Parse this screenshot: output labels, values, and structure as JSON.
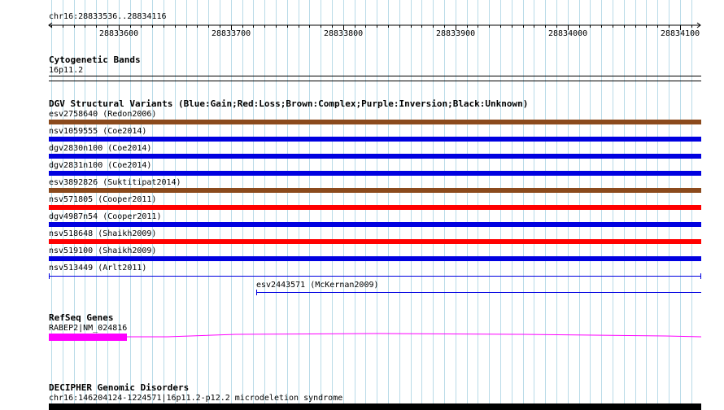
{
  "ruler": {
    "location": "chr16:28833536..28834116",
    "ticks": [
      "28833600",
      "28833700",
      "28833800",
      "28833900",
      "28834000",
      "28834100"
    ]
  },
  "cytoband": {
    "title": "Cytogenetic Bands",
    "band": "16p11.2"
  },
  "dgv": {
    "title": "DGV Structural Variants (Blue:Gain;Red:Loss;Brown:Complex;Purple:Inversion;Black:Unknown)",
    "variants": [
      {
        "label": "esv2758640 (Redon2006)",
        "color": "#8b4a1c"
      },
      {
        "label": "nsv1059555 (Coe2014)",
        "color": "#0000e0"
      },
      {
        "label": "dgv2830n100 (Coe2014)",
        "color": "#0000e0"
      },
      {
        "label": "dgv2831n100 (Coe2014)",
        "color": "#0000e0"
      },
      {
        "label": "esv3892826 (Suktitipat2014)",
        "color": "#8b4a1c"
      },
      {
        "label": "nsv571805 (Cooper2011)",
        "color": "#ff0000"
      },
      {
        "label": "dgv4987n54 (Cooper2011)",
        "color": "#0000e0"
      },
      {
        "label": "nsv518648 (Shaikh2009)",
        "color": "#ff0000"
      },
      {
        "label": "nsv519100 (Shaikh2009)",
        "color": "#0000e0"
      },
      {
        "label": "nsv513449 (Arlt2011)",
        "color": "#0000e0"
      },
      {
        "label": "esv2443571 (McKernan2009)",
        "color": "#0000e0"
      }
    ]
  },
  "refseq": {
    "title": "RefSeq Genes",
    "gene": "RABEP2|NM_024816",
    "color": "#ff00ff"
  },
  "decipher": {
    "title": "DECIPHER Genomic Disorders",
    "entry": "chr16:14620412­4-1224571|16p11.2-p12.2 microdeletion syndrome"
  }
}
